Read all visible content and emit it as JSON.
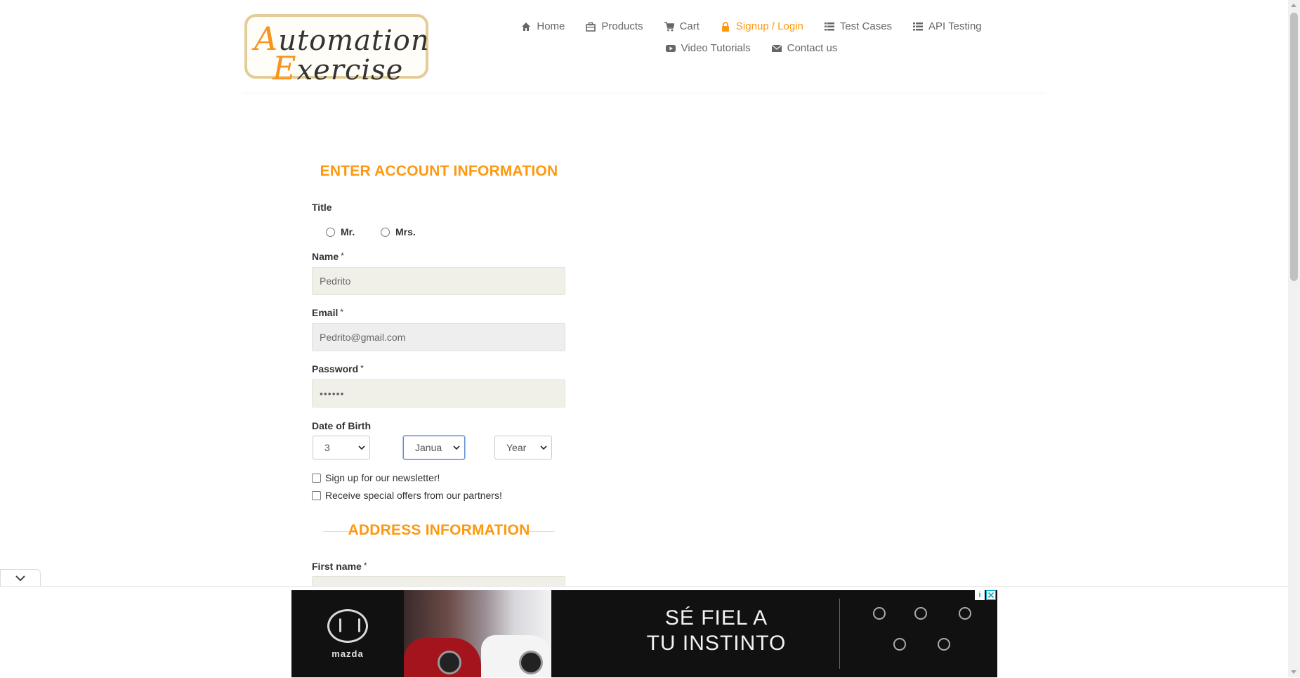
{
  "logo": {
    "line1_cap": "A",
    "line1_rest": "utomation",
    "line2_cap": "E",
    "line2_rest": "xercise"
  },
  "nav": {
    "row1": [
      {
        "label": "Home",
        "icon": "home-icon"
      },
      {
        "label": "Products",
        "icon": "products-icon"
      },
      {
        "label": "Cart",
        "icon": "cart-icon"
      },
      {
        "label": "Signup / Login",
        "icon": "lock-icon",
        "active": true
      },
      {
        "label": "Test Cases",
        "icon": "list-icon"
      },
      {
        "label": "API Testing",
        "icon": "list-icon"
      }
    ],
    "row2": [
      {
        "label": "Video Tutorials",
        "icon": "youtube-icon"
      },
      {
        "label": "Contact us",
        "icon": "envelope-icon"
      }
    ]
  },
  "form": {
    "heading": "ENTER ACCOUNT INFORMATION",
    "title_label": "Title",
    "title_options": [
      "Mr.",
      "Mrs."
    ],
    "name_label": "Name",
    "name_value": "Pedrito",
    "email_label": "Email",
    "email_value": "Pedrito@gmail.com",
    "password_label": "Password",
    "password_value": "••••••",
    "required_mark": "*",
    "dob_label": "Date of Birth",
    "dob_day": "3",
    "dob_month": "Janua",
    "dob_year": "Year",
    "newsletter_label": "Sign up for our newsletter!",
    "offers_label": "Receive special offers from our partners!",
    "address_heading": "ADDRESS INFORMATION",
    "first_name_label": "First name"
  },
  "ad": {
    "brand": "mazda",
    "slogan_line1": "SÉ FIEL A",
    "slogan_line2": "TU INSTINTO",
    "info_glyph": "i"
  },
  "colors": {
    "accent": "#fe980f",
    "input_bg": "#f0f0e9",
    "ad_bg": "#111111"
  }
}
